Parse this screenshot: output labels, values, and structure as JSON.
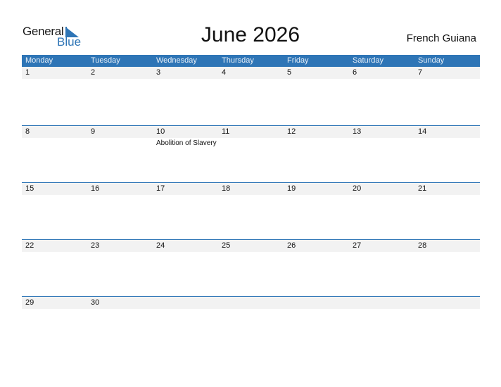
{
  "logo": {
    "word1": "General",
    "word2": "Blue"
  },
  "title": "June 2026",
  "country": "French Guiana",
  "colors": {
    "accent": "#2e75b6",
    "strip": "#f2f2f2"
  },
  "weekdays": [
    "Monday",
    "Tuesday",
    "Wednesday",
    "Thursday",
    "Friday",
    "Saturday",
    "Sunday"
  ],
  "weeks": [
    {
      "days": [
        "1",
        "2",
        "3",
        "4",
        "5",
        "6",
        "7"
      ],
      "events": [
        "",
        "",
        "",
        "",
        "",
        "",
        ""
      ]
    },
    {
      "days": [
        "8",
        "9",
        "10",
        "11",
        "12",
        "13",
        "14"
      ],
      "events": [
        "",
        "",
        "Abolition of Slavery",
        "",
        "",
        "",
        ""
      ]
    },
    {
      "days": [
        "15",
        "16",
        "17",
        "18",
        "19",
        "20",
        "21"
      ],
      "events": [
        "",
        "",
        "",
        "",
        "",
        "",
        ""
      ]
    },
    {
      "days": [
        "22",
        "23",
        "24",
        "25",
        "26",
        "27",
        "28"
      ],
      "events": [
        "",
        "",
        "",
        "",
        "",
        "",
        ""
      ]
    },
    {
      "days": [
        "29",
        "30",
        "",
        "",
        "",
        "",
        ""
      ],
      "events": [
        "",
        "",
        "",
        "",
        "",
        "",
        ""
      ]
    }
  ]
}
